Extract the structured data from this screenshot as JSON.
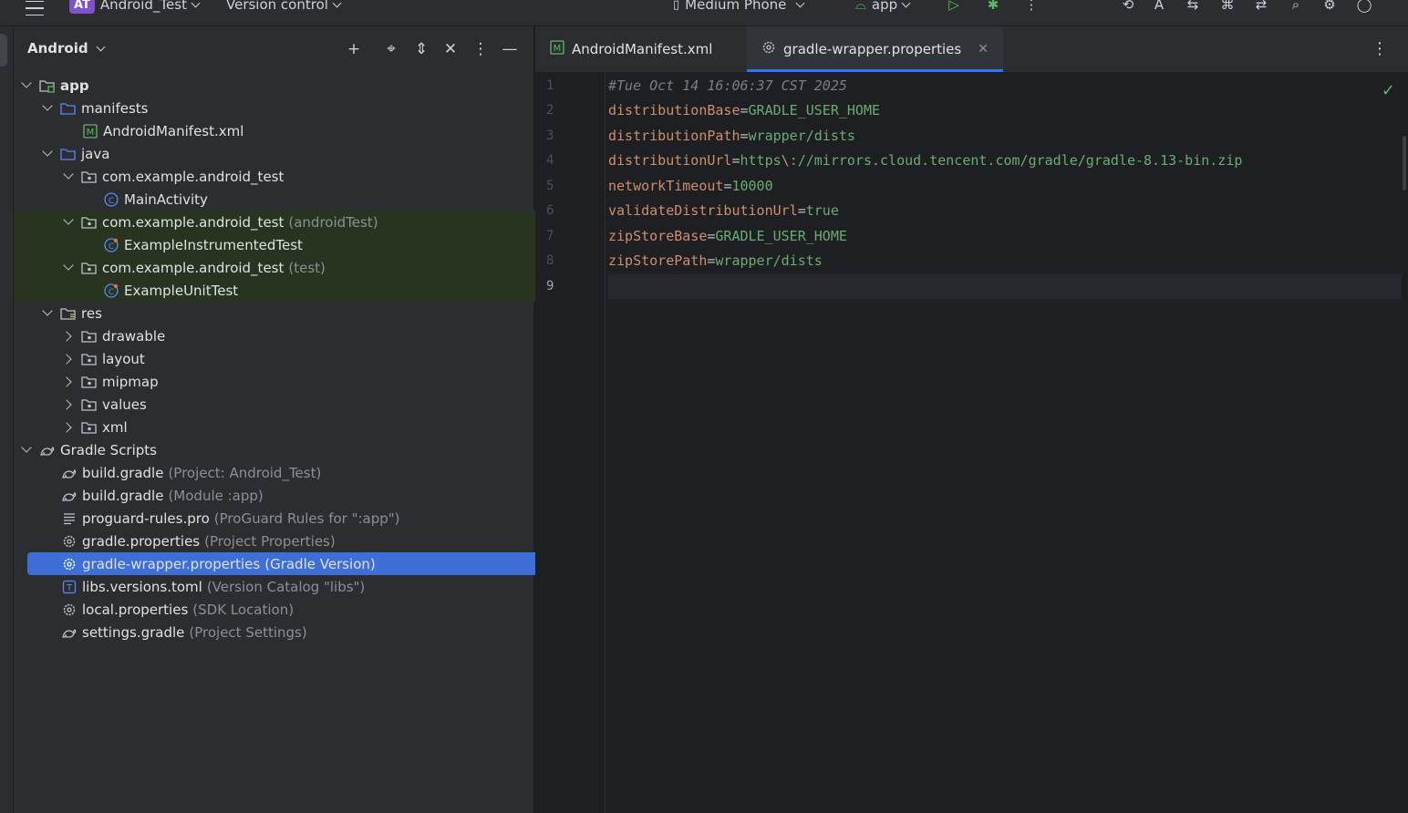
{
  "topbar": {
    "project_badge": "AT",
    "project_name": "Android_Test",
    "vcs": "Version control",
    "device": "Medium Phone",
    "run_config": "app"
  },
  "project_panel": {
    "title": "Android",
    "tree": [
      {
        "label": "app",
        "hint": "",
        "icon": "module-folder-icon"
      },
      {
        "label": "manifests",
        "hint": "",
        "icon": "folder-icon"
      },
      {
        "label": "AndroidManifest.xml",
        "hint": "",
        "icon": "manifest-file-icon"
      },
      {
        "label": "java",
        "hint": "",
        "icon": "folder-icon"
      },
      {
        "label": "com.example.android_test",
        "hint": "",
        "icon": "package-icon"
      },
      {
        "label": "MainActivity",
        "hint": "",
        "icon": "class-icon"
      },
      {
        "label": "com.example.android_test",
        "hint": "(androidTest)",
        "icon": "package-icon"
      },
      {
        "label": "ExampleInstrumentedTest",
        "hint": "",
        "icon": "test-class-icon"
      },
      {
        "label": "com.example.android_test",
        "hint": "(test)",
        "icon": "package-icon"
      },
      {
        "label": "ExampleUnitTest",
        "hint": "",
        "icon": "test-class-icon"
      },
      {
        "label": "res",
        "hint": "",
        "icon": "res-folder-icon"
      },
      {
        "label": "drawable",
        "hint": "",
        "icon": "package-icon"
      },
      {
        "label": "layout",
        "hint": "",
        "icon": "package-icon"
      },
      {
        "label": "mipmap",
        "hint": "",
        "icon": "package-icon"
      },
      {
        "label": "values",
        "hint": "",
        "icon": "package-icon"
      },
      {
        "label": "xml",
        "hint": "",
        "icon": "package-icon"
      },
      {
        "label": "Gradle Scripts",
        "hint": "",
        "icon": "gradle-icon"
      },
      {
        "label": "build.gradle",
        "hint": "(Project: Android_Test)",
        "icon": "gradle-icon"
      },
      {
        "label": "build.gradle",
        "hint": "(Module :app)",
        "icon": "gradle-icon"
      },
      {
        "label": "proguard-rules.pro",
        "hint": "(ProGuard Rules for \":app\")",
        "icon": "text-file-icon"
      },
      {
        "label": "gradle.properties",
        "hint": "(Project Properties)",
        "icon": "settings-file-icon"
      },
      {
        "label": "gradle-wrapper.properties",
        "hint": "(Gradle Version)",
        "icon": "settings-file-icon"
      },
      {
        "label": "libs.versions.toml",
        "hint": "(Version Catalog \"libs\")",
        "icon": "toml-file-icon"
      },
      {
        "label": "local.properties",
        "hint": "(SDK Location)",
        "icon": "settings-file-icon"
      },
      {
        "label": "settings.gradle",
        "hint": "(Project Settings)",
        "icon": "gradle-icon"
      }
    ]
  },
  "editor": {
    "tabs": [
      {
        "label": "AndroidManifest.xml",
        "icon": "manifest-file-icon"
      },
      {
        "label": "gradle-wrapper.properties",
        "icon": "settings-file-icon"
      }
    ],
    "active_tab": "gradle-wrapper.properties",
    "line_numbers": [
      "1",
      "2",
      "3",
      "4",
      "5",
      "6",
      "7",
      "8",
      "9"
    ],
    "code": {
      "comment": "#Tue Oct 14 16:06:37 CST 2025",
      "lines": [
        {
          "key": "distributionBase",
          "value": "GRADLE_USER_HOME"
        },
        {
          "key": "distributionPath",
          "value": "wrapper/dists"
        },
        {
          "key": "distributionUrl",
          "value_pre": "https",
          "escape": "\\",
          "value_post": "://mirrors.cloud.tencent.com/gradle/gradle-8.13-bin.zip"
        },
        {
          "key": "networkTimeout",
          "value": "10000"
        },
        {
          "key": "validateDistributionUrl",
          "value": "true"
        },
        {
          "key": "zipStoreBase",
          "value": "GRADLE_USER_HOME"
        },
        {
          "key": "zipStorePath",
          "value": "wrapper/dists"
        }
      ],
      "eq": "="
    }
  },
  "colors": {
    "accent": "#3574f0",
    "selection": "#3d6fd6",
    "test_bg": "#283320",
    "project_badge": "#7f52c6",
    "key": "#cf8e6d",
    "value": "#6aab73"
  }
}
